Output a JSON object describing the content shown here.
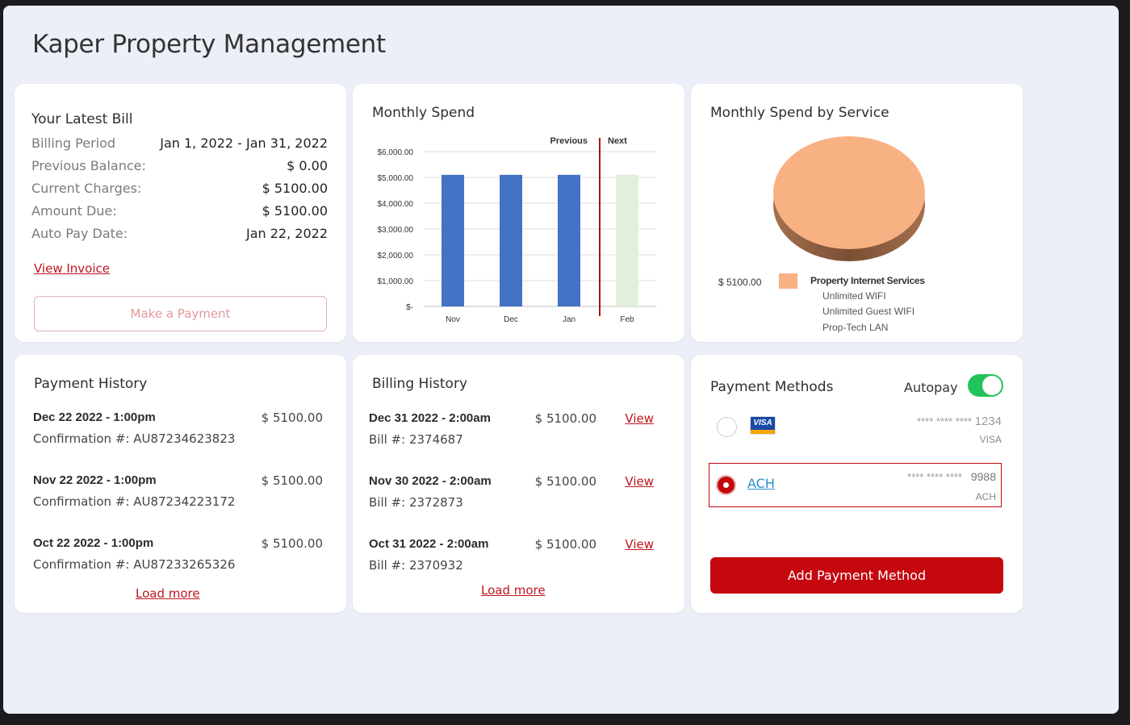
{
  "app": {
    "title": "Kaper Property Management"
  },
  "latest_bill": {
    "title": "Your Latest Bill",
    "rows": [
      {
        "label": "Billing Period",
        "value": "Jan 1, 2022 - Jan 31, 2022"
      },
      {
        "label": "Previous Balance:",
        "value": "$ 0.00"
      },
      {
        "label": "Current Charges:",
        "value": "$ 5100.00"
      },
      {
        "label": "Amount Due:",
        "value": "$ 5100.00"
      },
      {
        "label": "Auto Pay Date:",
        "value": "Jan 22, 2022"
      }
    ],
    "view_invoice": "View Invoice",
    "make_payment": "Make a Payment"
  },
  "monthly_spend": {
    "title": "Monthly Spend",
    "previous_label": "Previous",
    "next_label": "Next"
  },
  "chart_data": {
    "type": "bar",
    "title": "Monthly Spend",
    "categories": [
      "Nov",
      "Dec",
      "Jan",
      "Feb"
    ],
    "values": [
      5100,
      5100,
      5100,
      5100
    ],
    "bar_colors": [
      "#4472c4",
      "#4472c4",
      "#4472c4",
      "#e2efda"
    ],
    "ylim": [
      0,
      6000
    ],
    "yticks": [
      0,
      1000,
      2000,
      3000,
      4000,
      5000,
      6000
    ],
    "ytick_labels": [
      "$-",
      "$1,000.00",
      "$2,000.00",
      "$3,000.00",
      "$4,000.00",
      "$5,000.00",
      "$6,000.00"
    ],
    "grid": true,
    "divider_color": "#b01016"
  },
  "spend_by_service": {
    "title": "Monthly Spend by Service",
    "amount": "$ 5100.00",
    "service_name": "Property Internet Services",
    "service_color": "#f7b183",
    "sub_items": [
      "Unlimited WIFI",
      "Unlimited Guest WIFI",
      "Prop-Tech LAN"
    ]
  },
  "payment_history": {
    "title": "Payment History",
    "items": [
      {
        "date": "Dec 22 2022 - 1:00pm",
        "amount": "$ 5100.00",
        "confirmation": "Confirmation #: AU87234623823"
      },
      {
        "date": "Nov 22 2022 - 1:00pm",
        "amount": "$ 5100.00",
        "confirmation": "Confirmation #: AU87234223172"
      },
      {
        "date": "Oct 22 2022 - 1:00pm",
        "amount": "$ 5100.00",
        "confirmation": "Confirmation #: AU87233265326"
      }
    ],
    "load_more": "Load more"
  },
  "billing_history": {
    "title": "Billing History",
    "items": [
      {
        "date": "Dec 31 2022 - 2:00am",
        "amount": "$ 5100.00",
        "bill": "Bill #: 2374687",
        "view": "View"
      },
      {
        "date": "Nov 30 2022 - 2:00am",
        "amount": "$ 5100.00",
        "bill": "Bill #: 2372873",
        "view": "View"
      },
      {
        "date": "Oct 31 2022 - 2:00am",
        "amount": "$ 5100.00",
        "bill": "Bill #: 2370932",
        "view": "View"
      }
    ],
    "load_more": "Load more"
  },
  "payment_methods": {
    "title": "Payment Methods",
    "autopay_label": "Autopay",
    "autopay_on": true,
    "methods": [
      {
        "logo": "VISA",
        "mask": "**** **** ****",
        "last4": "1234",
        "type": "VISA",
        "selected": false
      },
      {
        "logo": "ACH",
        "mask": "**** **** ****",
        "last4": "9988",
        "type": "ACH",
        "selected": true
      }
    ],
    "add_button": "Add Payment Method"
  },
  "colors": {
    "accent": "#c4080e",
    "toggle_on": "#22c35a",
    "background": "#eceff8"
  }
}
